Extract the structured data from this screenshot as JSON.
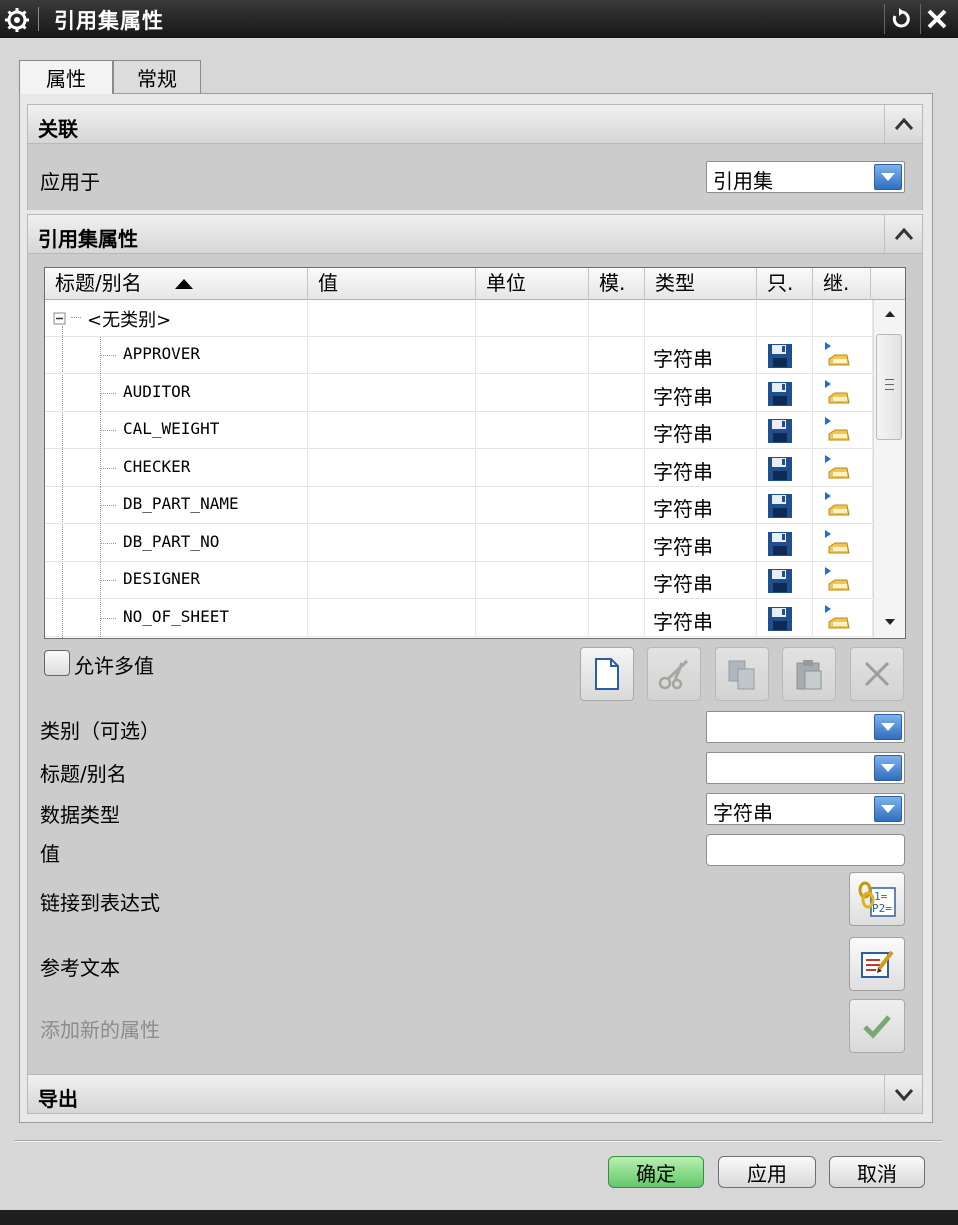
{
  "window": {
    "title": "引用集属性"
  },
  "tabs": [
    {
      "label": "属性",
      "active": true
    },
    {
      "label": "常规",
      "active": false
    }
  ],
  "association": {
    "header": "关联",
    "apply_to_label": "应用于",
    "apply_to_value": "引用集"
  },
  "attributes": {
    "header": "引用集属性",
    "columns": [
      "标题/别名",
      "值",
      "单位",
      "模.",
      "类型",
      "只.",
      "继."
    ],
    "root_label": "<无类别>",
    "rows": [
      {
        "name": "APPROVER",
        "type": "字符串"
      },
      {
        "name": "AUDITOR",
        "type": "字符串"
      },
      {
        "name": "CAL_WEIGHT",
        "type": "字符串"
      },
      {
        "name": "CHECKER",
        "type": "字符串"
      },
      {
        "name": "DB_PART_NAME",
        "type": "字符串"
      },
      {
        "name": "DB_PART_NO",
        "type": "字符串"
      },
      {
        "name": "DESIGNER",
        "type": "字符串"
      },
      {
        "name": "NO_OF_SHEET",
        "type": "字符串"
      }
    ],
    "allow_multi_label": "允许多值",
    "category_label": "类别（可选）",
    "category_value": "",
    "title_label": "标题/别名",
    "title_value": "",
    "datatype_label": "数据类型",
    "datatype_value": "字符串",
    "value_label": "值",
    "value_value": "",
    "link_expr_label": "链接到表达式",
    "ref_text_label": "参考文本",
    "add_new_label": "添加新的属性"
  },
  "export": {
    "header": "导出"
  },
  "footer": {
    "ok": "确定",
    "apply": "应用",
    "cancel": "取消"
  },
  "colors": {
    "title_bar": "#1f1f1f",
    "ok_button": "#62c86a",
    "combo_arrow": "#2f6fc1"
  }
}
